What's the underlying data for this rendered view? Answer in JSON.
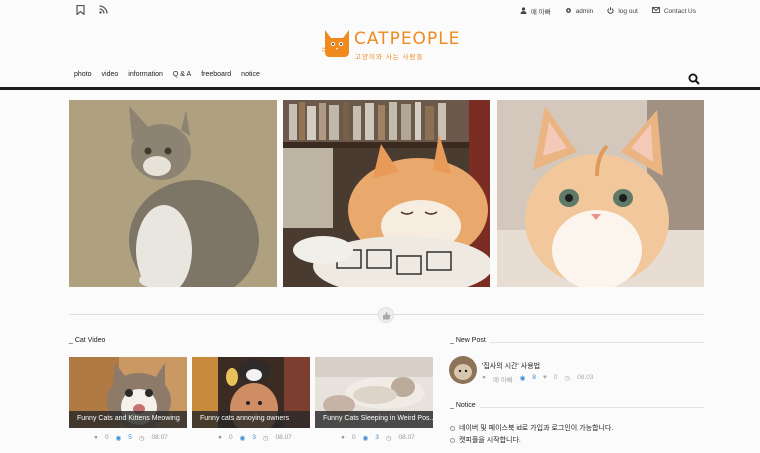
{
  "topbar": {
    "bookmark_icon": "bookmark-icon",
    "rss_icon": "rss-icon",
    "links": [
      {
        "icon": "user-icon",
        "label": "매 아빠"
      },
      {
        "icon": "gear-icon",
        "label": "admin"
      },
      {
        "icon": "power-icon",
        "label": "log out"
      },
      {
        "icon": "mail-icon",
        "label": "Contact Us"
      }
    ]
  },
  "logo": {
    "word": "CATPEOPLE",
    "tagline": "고양이와 사는 사람들",
    "color": "#f0891e"
  },
  "nav": {
    "items": [
      "photo",
      "video",
      "information",
      "Q & A",
      "freeboard",
      "notice"
    ],
    "search_icon": "search-icon"
  },
  "sections": {
    "cat_video": "_ Cat Video",
    "new_post": "_ New Post",
    "notice": "_ Notice"
  },
  "videos": [
    {
      "title": "Funny Cats and Kittens Meowing",
      "comments": "0",
      "views": "5",
      "date": "08.07"
    },
    {
      "title": "Funny cats annoying owners",
      "comments": "0",
      "views": "3",
      "date": "08.07"
    },
    {
      "title": "Funny Cats Sleeping in Weird Pos...",
      "comments": "0",
      "views": "3",
      "date": "08.07"
    }
  ],
  "new_post": {
    "title": "'집사의 시간' 사용법",
    "author": "매 아빠",
    "views": "8",
    "likes": "0",
    "date": "08.03"
  },
  "notices": [
    "네이버 및 페이스북 id로 가입과 로그인이 가능합니다.",
    "캣피플을 시작합니다."
  ]
}
